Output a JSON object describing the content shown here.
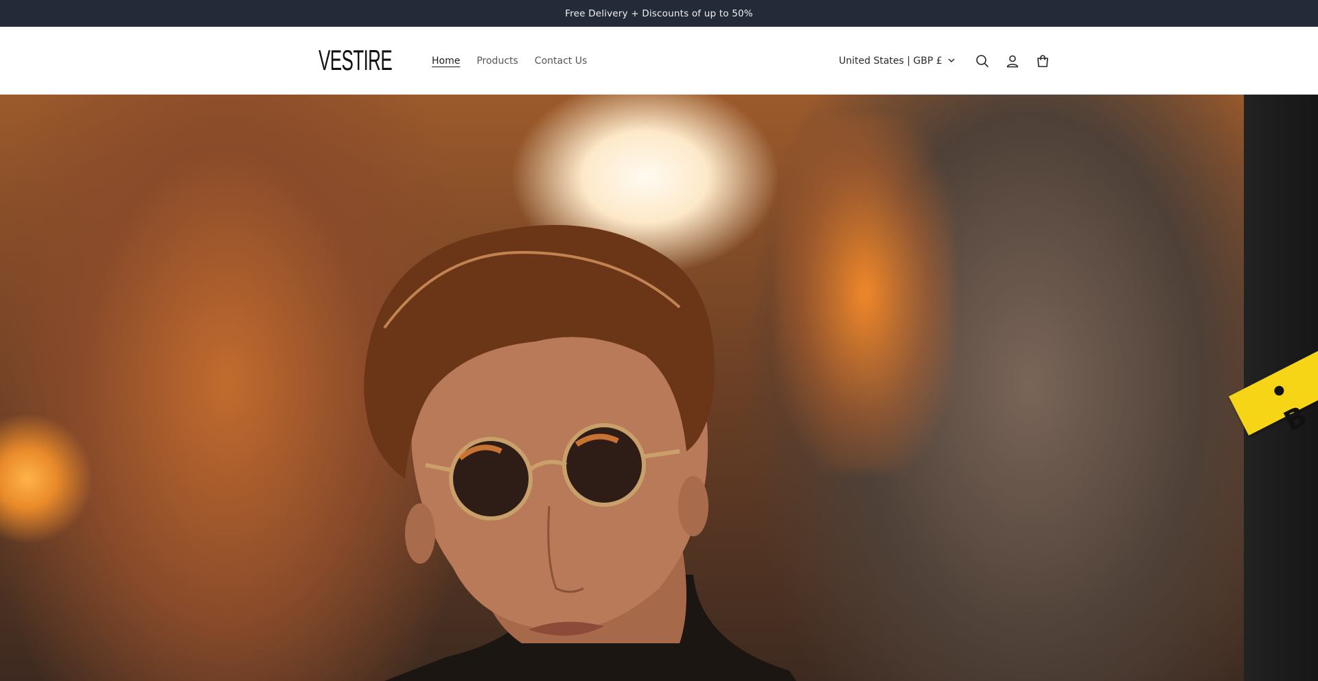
{
  "announcement": {
    "text": "Free Delivery + Discounts of up to 50%"
  },
  "header": {
    "logo": "VESTIRE",
    "nav": [
      {
        "label": "Home",
        "active": true
      },
      {
        "label": "Products",
        "active": false
      },
      {
        "label": "Contact Us",
        "active": false
      }
    ],
    "locale": "United States | GBP £",
    "icons": [
      "search-icon",
      "account-icon",
      "cart-icon"
    ]
  },
  "hero": {
    "image": "portrait of a man with sunglasses against an orange sunset street background",
    "tape_text": "• B"
  },
  "colors": {
    "announcement_bg": "#232b38",
    "tape": "#f5d515"
  }
}
